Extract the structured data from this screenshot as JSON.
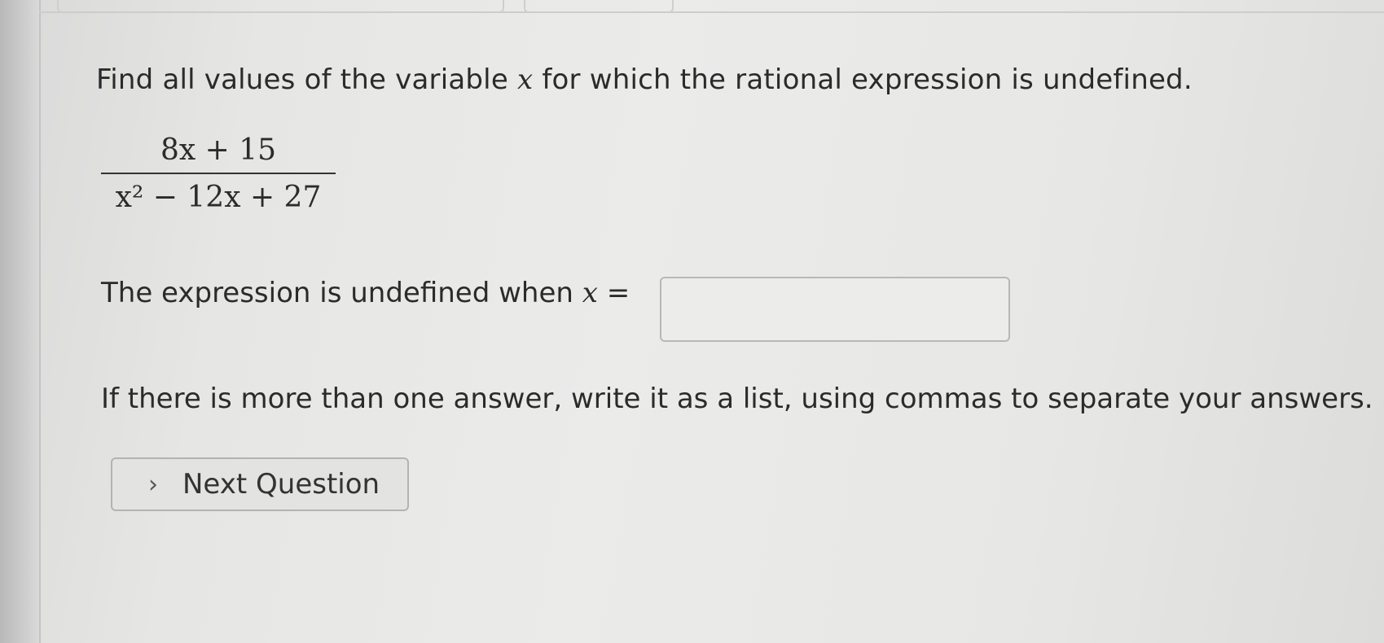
{
  "question": {
    "prompt_before_var": "Find all values of the variable",
    "variable": "x",
    "prompt_after_var": "for which the rational expression is undefined."
  },
  "expression": {
    "numerator": "8x + 15",
    "denominator": "x² − 12x + 27"
  },
  "answer": {
    "label": "The expression is undefined when",
    "variable": "x",
    "equals": "=",
    "value": "",
    "placeholder": ""
  },
  "instructions": "If there is more than one answer, write it as a list, using commas to separate your answers.",
  "next_button": {
    "icon": "chevron-right-icon",
    "label": "Next Question"
  }
}
